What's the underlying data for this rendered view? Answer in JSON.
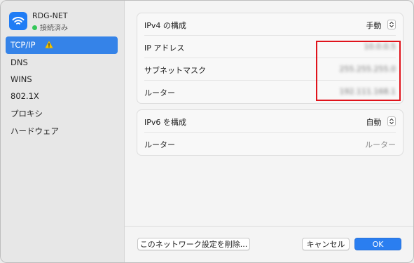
{
  "network": {
    "name": "RDG-NET",
    "status": "接続済み"
  },
  "sidebar": {
    "items": [
      {
        "label": "TCP/IP",
        "selected": true,
        "warning": true
      },
      {
        "label": "DNS"
      },
      {
        "label": "WINS"
      },
      {
        "label": "802.1X"
      },
      {
        "label": "プロキシ"
      },
      {
        "label": "ハードウェア"
      }
    ]
  },
  "ipv4": {
    "config_label": "IPv4 の構成",
    "config_value": "手動",
    "rows": [
      {
        "label": "IP アドレス",
        "value": "10.0.0.5"
      },
      {
        "label": "サブネットマスク",
        "value": "255.255.255.0"
      },
      {
        "label": "ルーター",
        "value": "192.111.168.1"
      }
    ]
  },
  "ipv6": {
    "config_label": "IPv6 を構成",
    "config_value": "自動",
    "router_label": "ルーター",
    "router_value": "ルーター"
  },
  "footer": {
    "delete_label": "このネットワーク設定を削除...",
    "cancel_label": "キャンセル",
    "ok_label": "OK"
  },
  "colors": {
    "accent": "#2a7ef0",
    "selected_bg": "#3583e8",
    "status_green": "#34c759",
    "warning": "#f5c400",
    "highlight_box": "#e0131b"
  }
}
